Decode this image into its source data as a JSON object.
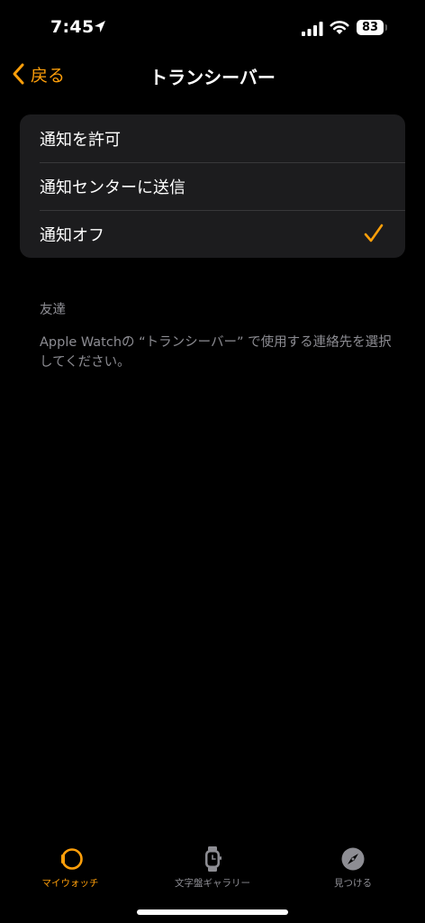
{
  "status_bar": {
    "time": "7:45",
    "battery": "83"
  },
  "nav": {
    "back_label": "戻る",
    "title": "トランシーバー"
  },
  "options": [
    {
      "label": "通知を許可",
      "selected": false
    },
    {
      "label": "通知センターに送信",
      "selected": false
    },
    {
      "label": "通知オフ",
      "selected": true
    }
  ],
  "friends": {
    "header": "友達",
    "description": "Apple Watchの “トランシーバー” で使用する連絡先を選択してください。"
  },
  "tab_bar": {
    "tabs": [
      {
        "label": "マイウォッチ",
        "icon": "watch-icon",
        "active": true
      },
      {
        "label": "文字盤ギャラリー",
        "icon": "watch-face-icon",
        "active": false
      },
      {
        "label": "見つける",
        "icon": "compass-icon",
        "active": false
      }
    ]
  },
  "colors": {
    "accent": "#ff9f0a",
    "background": "#000000",
    "group_background": "#1c1c1e",
    "secondary_text": "#8d8d93"
  }
}
